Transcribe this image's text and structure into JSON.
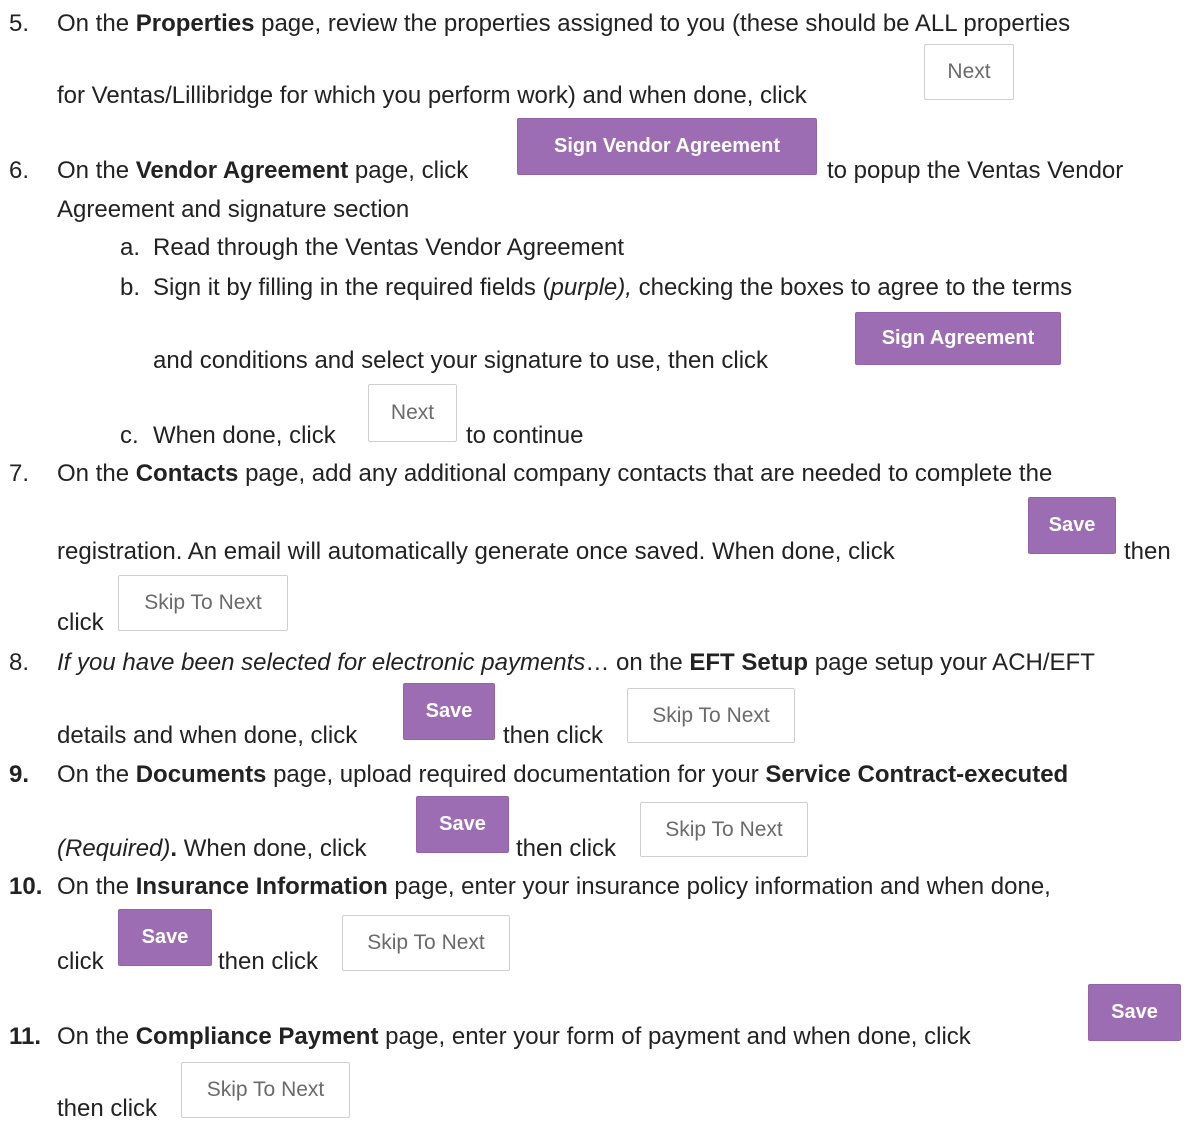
{
  "steps": {
    "s5": {
      "num": "5.",
      "l1": {
        "a": "On the ",
        "b": "Properties",
        "c": " page, review the properties assigned to you (these should be ALL properties"
      },
      "l2": "for Ventas/Lillibridge for which you perform work) and when done, click"
    },
    "s6": {
      "num": "6.",
      "l1": {
        "a": "On the ",
        "b": "Vendor Agreement",
        "c": " page, click",
        "d": "to popup the Ventas Vendor"
      },
      "l2": "Agreement and signature section",
      "a": {
        "marker": "a.",
        "text": "Read through the Ventas Vendor Agreement"
      },
      "b": {
        "marker": "b.",
        "l1a": "Sign it by filling in the required fields (",
        "l1i": "purple),",
        "l1c": " checking the boxes to agree to the terms",
        "l2": "and conditions and select your signature to use, then click"
      },
      "c": {
        "marker": "c.",
        "a": "When done, click",
        "b": "to continue"
      }
    },
    "s7": {
      "num": "7.",
      "l1": {
        "a": "On the ",
        "b": "Contacts",
        "c": " page, add any additional company contacts that are needed to complete the"
      },
      "l2": {
        "a": "registration.  An email will automatically generate once saved.  When done, click",
        "b": "then"
      },
      "l3": "click"
    },
    "s8": {
      "num": "8.",
      "l1": {
        "i": "If you have been selected  for electronic payments",
        "a": "… on the ",
        "b": "EFT Setup",
        "c": " page setup your ACH/EFT"
      },
      "l2": {
        "a": "details and when done, click",
        "b": "then click"
      }
    },
    "s9": {
      "num": "9.",
      "l1": {
        "a": "On the ",
        "b": "Documents",
        "c": " page, upload required documentation for your ",
        "d": "Service Contract-executed"
      },
      "l2": {
        "i": "(Required)",
        "p": ".",
        "a": "  When done, click",
        "b": "then click"
      }
    },
    "s10": {
      "num": "10.",
      "l1": {
        "a": "On the ",
        "b": "Insurance Information",
        "c": " page, enter your insurance policy information and when done,"
      },
      "l2": {
        "a": "click",
        "b": "then click"
      }
    },
    "s11": {
      "num": "11.",
      "l1": {
        "a": "On the ",
        "b": "Compliance Payment",
        "c": " page, enter your form of payment and when done, click"
      },
      "l2": "then click"
    }
  },
  "buttons": {
    "next": "Next",
    "sign_vendor_agreement": "Sign Vendor Agreement",
    "sign_agreement": "Sign Agreement",
    "save": "Save",
    "skip_to_next": "Skip To Next"
  },
  "colors": {
    "accent_purple": "#9d6db3",
    "outline_border": "#cfcfcf",
    "outline_text": "#6a6a6a"
  }
}
